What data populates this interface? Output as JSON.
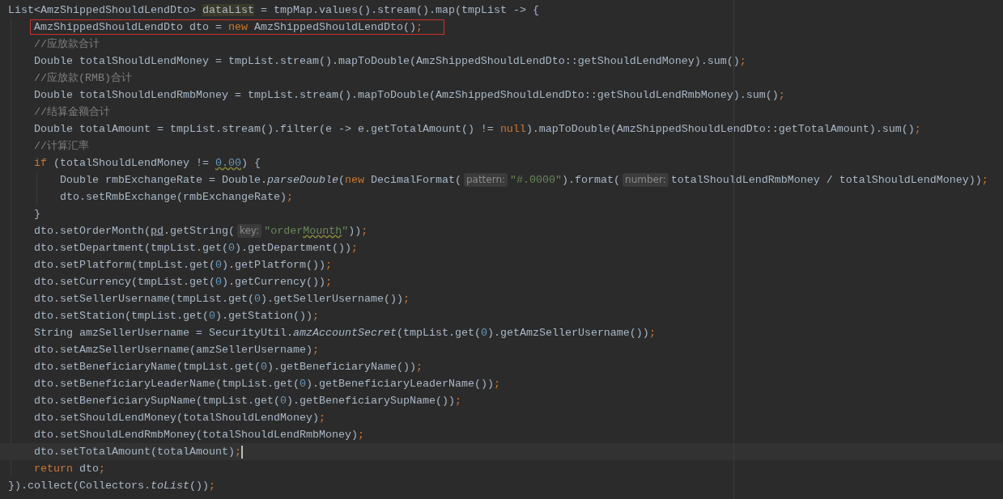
{
  "editor": {
    "lines": [
      {
        "current": false,
        "boxed": false,
        "tokens": [
          {
            "kind": "plain",
            "text": "List<AmzShippedShouldLendDto> "
          },
          {
            "kind": "highlight",
            "text": "dataList"
          },
          {
            "kind": "plain",
            "text": " = tmpMap.values().stream().map(tmpList -> {"
          }
        ],
        "children": [
          {
            "current": false,
            "boxed": true,
            "tokens": [
              {
                "kind": "plain",
                "text": "AmzShippedShouldLendDto dto = "
              },
              {
                "kind": "keyword",
                "text": "new"
              },
              {
                "kind": "plain",
                "text": " AmzShippedShouldLendDto()"
              },
              {
                "kind": "punct",
                "text": ";"
              }
            ]
          },
          {
            "current": false,
            "boxed": false,
            "tokens": [
              {
                "kind": "comment",
                "text": "//应放款合计"
              }
            ]
          },
          {
            "current": false,
            "boxed": false,
            "tokens": [
              {
                "kind": "plain",
                "text": "Double totalShouldLendMoney = tmpList.stream().mapToDouble(AmzShippedShouldLendDto::getShouldLendMoney).sum()"
              },
              {
                "kind": "punct",
                "text": ";"
              }
            ]
          },
          {
            "current": false,
            "boxed": false,
            "tokens": [
              {
                "kind": "comment",
                "text": "//应放款(RMB)合计"
              }
            ]
          },
          {
            "current": false,
            "boxed": false,
            "tokens": [
              {
                "kind": "plain",
                "text": "Double totalShouldLendRmbMoney = tmpList.stream().mapToDouble(AmzShippedShouldLendDto::getShouldLendRmbMoney).sum()"
              },
              {
                "kind": "punct",
                "text": ";"
              }
            ]
          },
          {
            "current": false,
            "boxed": false,
            "tokens": [
              {
                "kind": "comment",
                "text": "//结算金额合计"
              }
            ]
          },
          {
            "current": false,
            "boxed": false,
            "tokens": [
              {
                "kind": "plain",
                "text": "Double totalAmount = tmpList.stream().filter(e -> e.getTotalAmount() != "
              },
              {
                "kind": "keyword",
                "text": "null"
              },
              {
                "kind": "plain",
                "text": ").mapToDouble(AmzShippedShouldLendDto::getTotalAmount).sum()"
              },
              {
                "kind": "punct",
                "text": ";"
              }
            ]
          },
          {
            "current": false,
            "boxed": false,
            "tokens": [
              {
                "kind": "comment",
                "text": "//计算汇率"
              }
            ]
          },
          {
            "current": false,
            "boxed": false,
            "tokens": [
              {
                "kind": "keyword",
                "text": "if"
              },
              {
                "kind": "plain",
                "text": " (totalShouldLendMoney != "
              },
              {
                "kind": "warn-number",
                "text": "0.00"
              },
              {
                "kind": "plain",
                "text": ") {"
              }
            ],
            "children": [
              {
                "current": false,
                "boxed": false,
                "tokens": [
                  {
                    "kind": "plain",
                    "text": "Double rmbExchangeRate = Double."
                  },
                  {
                    "kind": "static",
                    "text": "parseDouble"
                  },
                  {
                    "kind": "plain",
                    "text": "("
                  },
                  {
                    "kind": "keyword",
                    "text": "new"
                  },
                  {
                    "kind": "plain",
                    "text": " DecimalFormat("
                  },
                  {
                    "kind": "hint",
                    "text": "pattern:"
                  },
                  {
                    "kind": "string",
                    "text": "\"#.0000\""
                  },
                  {
                    "kind": "plain",
                    "text": ").format("
                  },
                  {
                    "kind": "hint",
                    "text": "number:"
                  },
                  {
                    "kind": "plain",
                    "text": "totalShouldLendRmbMoney / totalShouldLendMoney))"
                  },
                  {
                    "kind": "punct",
                    "text": ";"
                  }
                ]
              },
              {
                "current": false,
                "boxed": false,
                "tokens": [
                  {
                    "kind": "plain",
                    "text": "dto.setRmbExchange(rmbExchangeRate)"
                  },
                  {
                    "kind": "punct",
                    "text": ";"
                  }
                ]
              }
            ]
          },
          {
            "current": false,
            "boxed": false,
            "tokens": [
              {
                "kind": "plain",
                "text": "}"
              }
            ]
          },
          {
            "current": false,
            "boxed": false,
            "tokens": [
              {
                "kind": "plain",
                "text": "dto.setOrderMonth("
              },
              {
                "kind": "underlined",
                "text": "pd"
              },
              {
                "kind": "plain",
                "text": ".getString("
              },
              {
                "kind": "hint",
                "text": "key:"
              },
              {
                "kind": "string",
                "text": "\"order"
              },
              {
                "kind": "typo-string",
                "text": "Mounth"
              },
              {
                "kind": "string",
                "text": "\""
              },
              {
                "kind": "plain",
                "text": "))"
              },
              {
                "kind": "punct",
                "text": ";"
              }
            ]
          },
          {
            "current": false,
            "boxed": false,
            "tokens": [
              {
                "kind": "plain",
                "text": "dto.setDepartment(tmpList.get("
              },
              {
                "kind": "number",
                "text": "0"
              },
              {
                "kind": "plain",
                "text": ").getDepartment())"
              },
              {
                "kind": "punct",
                "text": ";"
              }
            ]
          },
          {
            "current": false,
            "boxed": false,
            "tokens": [
              {
                "kind": "plain",
                "text": "dto.setPlatform(tmpList.get("
              },
              {
                "kind": "number",
                "text": "0"
              },
              {
                "kind": "plain",
                "text": ").getPlatform())"
              },
              {
                "kind": "punct",
                "text": ";"
              }
            ]
          },
          {
            "current": false,
            "boxed": false,
            "tokens": [
              {
                "kind": "plain",
                "text": "dto.setCurrency(tmpList.get("
              },
              {
                "kind": "number",
                "text": "0"
              },
              {
                "kind": "plain",
                "text": ").getCurrency())"
              },
              {
                "kind": "punct",
                "text": ";"
              }
            ]
          },
          {
            "current": false,
            "boxed": false,
            "tokens": [
              {
                "kind": "plain",
                "text": "dto.setSellerUsername(tmpList.get("
              },
              {
                "kind": "number",
                "text": "0"
              },
              {
                "kind": "plain",
                "text": ").getSellerUsername())"
              },
              {
                "kind": "punct",
                "text": ";"
              }
            ]
          },
          {
            "current": false,
            "boxed": false,
            "tokens": [
              {
                "kind": "plain",
                "text": "dto.setStation(tmpList.get("
              },
              {
                "kind": "number",
                "text": "0"
              },
              {
                "kind": "plain",
                "text": ").getStation())"
              },
              {
                "kind": "punct",
                "text": ";"
              }
            ]
          },
          {
            "current": false,
            "boxed": false,
            "tokens": [
              {
                "kind": "plain",
                "text": "String amzSellerUsername = SecurityUtil."
              },
              {
                "kind": "static",
                "text": "amzAccountSecret"
              },
              {
                "kind": "plain",
                "text": "(tmpList.get("
              },
              {
                "kind": "number",
                "text": "0"
              },
              {
                "kind": "plain",
                "text": ").getAmzSellerUsername())"
              },
              {
                "kind": "punct",
                "text": ";"
              }
            ]
          },
          {
            "current": false,
            "boxed": false,
            "tokens": [
              {
                "kind": "plain",
                "text": "dto.setAmzSellerUsername(amzSellerUsername)"
              },
              {
                "kind": "punct",
                "text": ";"
              }
            ]
          },
          {
            "current": false,
            "boxed": false,
            "tokens": [
              {
                "kind": "plain",
                "text": "dto.setBeneficiaryName(tmpList.get("
              },
              {
                "kind": "number",
                "text": "0"
              },
              {
                "kind": "plain",
                "text": ").getBeneficiaryName())"
              },
              {
                "kind": "punct",
                "text": ";"
              }
            ]
          },
          {
            "current": false,
            "boxed": false,
            "tokens": [
              {
                "kind": "plain",
                "text": "dto.setBeneficiaryLeaderName(tmpList.get("
              },
              {
                "kind": "number",
                "text": "0"
              },
              {
                "kind": "plain",
                "text": ").getBeneficiaryLeaderName())"
              },
              {
                "kind": "punct",
                "text": ";"
              }
            ]
          },
          {
            "current": false,
            "boxed": false,
            "tokens": [
              {
                "kind": "plain",
                "text": "dto.setBeneficiarySupName(tmpList.get("
              },
              {
                "kind": "number",
                "text": "0"
              },
              {
                "kind": "plain",
                "text": ").getBeneficiarySupName())"
              },
              {
                "kind": "punct",
                "text": ";"
              }
            ]
          },
          {
            "current": false,
            "boxed": false,
            "tokens": [
              {
                "kind": "plain",
                "text": "dto.setShouldLendMoney(totalShouldLendMoney)"
              },
              {
                "kind": "punct",
                "text": ";"
              }
            ]
          },
          {
            "current": false,
            "boxed": false,
            "tokens": [
              {
                "kind": "plain",
                "text": "dto.setShouldLendRmbMoney(totalShouldLendRmbMoney)"
              },
              {
                "kind": "punct",
                "text": ";"
              }
            ]
          },
          {
            "current": true,
            "boxed": false,
            "tokens": [
              {
                "kind": "plain",
                "text": "dto.setTotalAmount(totalAmount)"
              },
              {
                "kind": "punct",
                "text": ";"
              }
            ]
          },
          {
            "current": false,
            "boxed": false,
            "tokens": [
              {
                "kind": "keyword",
                "text": "return"
              },
              {
                "kind": "plain",
                "text": " dto"
              },
              {
                "kind": "punct",
                "text": ";"
              }
            ]
          }
        ]
      },
      {
        "current": false,
        "boxed": false,
        "tokens": [
          {
            "kind": "plain",
            "text": "}).collect(Collectors."
          },
          {
            "kind": "static",
            "text": "toList"
          },
          {
            "kind": "plain",
            "text": "())"
          },
          {
            "kind": "punct",
            "text": ";"
          }
        ]
      }
    ]
  }
}
